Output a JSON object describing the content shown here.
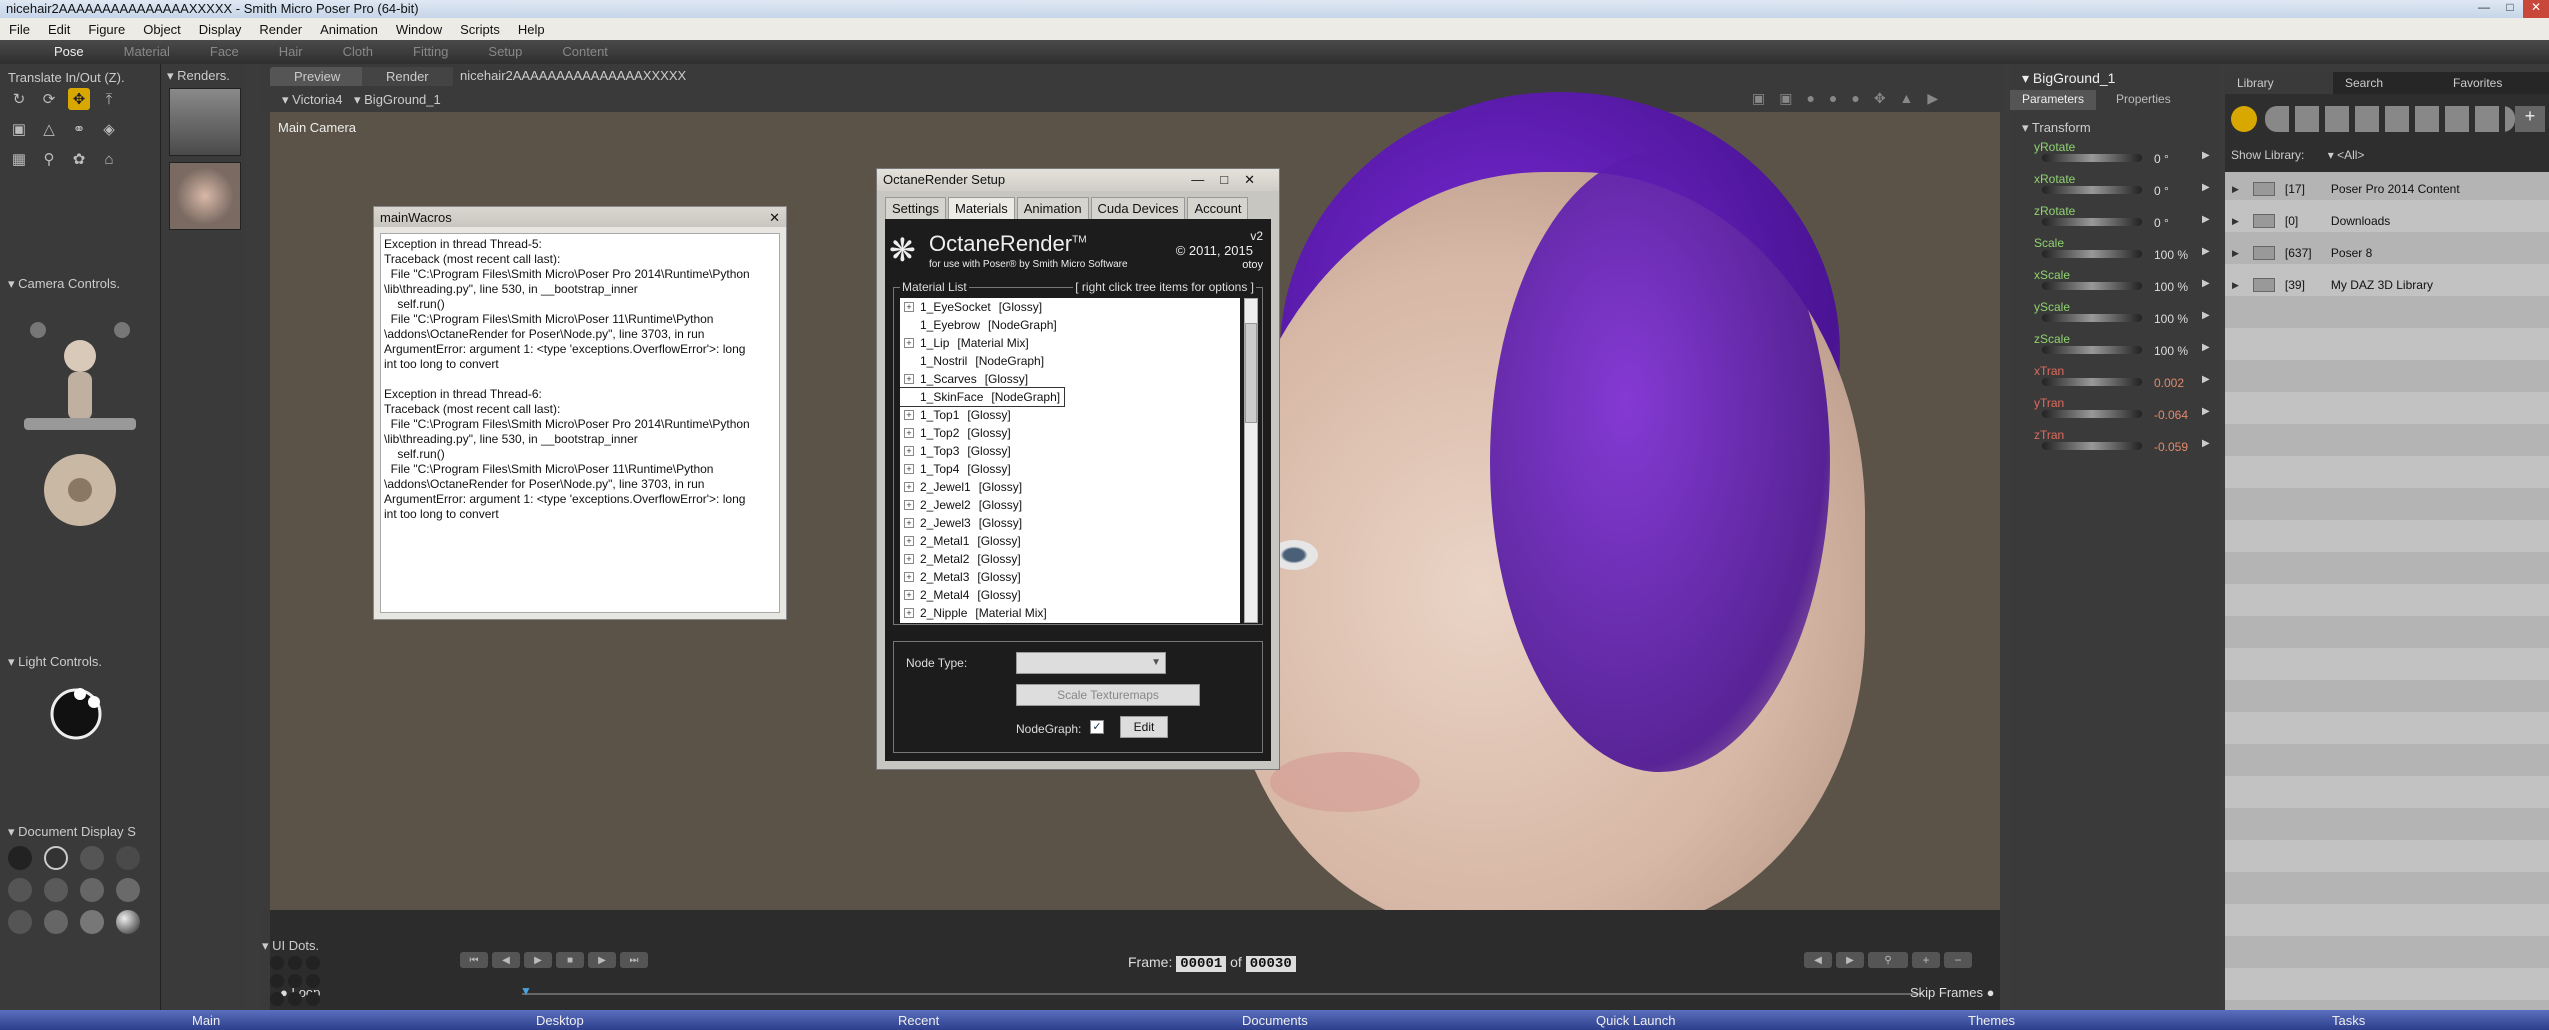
{
  "window": {
    "title": "nicehair2AAAAAAAAAAAAAAAXXXXX - Smith Micro Poser Pro  (64-bit)"
  },
  "menu": [
    "File",
    "Edit",
    "Figure",
    "Object",
    "Display",
    "Render",
    "Animation",
    "Window",
    "Scripts",
    "Help"
  ],
  "rooms": [
    "Pose",
    "Material",
    "Face",
    "Hair",
    "Cloth",
    "Fitting",
    "Setup",
    "Content"
  ],
  "tools": {
    "title": "Translate In/Out (Z)."
  },
  "renders": {
    "title": "Renders."
  },
  "doc_tabs": [
    "Preview",
    "Render"
  ],
  "doc_name": "nicehair2AAAAAAAAAAAAAAAXXXXX",
  "figure_menu": "Victoria4",
  "actor_menu": "BigGround_1",
  "camera_label": "Main Camera",
  "camera_controls": {
    "title": "Camera Controls."
  },
  "light_controls": {
    "title": "Light Controls."
  },
  "doc_display": {
    "title": "Document Display S"
  },
  "ui_dots": {
    "title": "UI Dots."
  },
  "mainwacros": {
    "title": "mainWacros",
    "text": "Exception in thread Thread-5:\nTraceback (most recent call last):\n  File \"C:\\Program Files\\Smith Micro\\Poser Pro 2014\\Runtime\\Python\n\\lib\\threading.py\", line 530, in __bootstrap_inner\n    self.run()\n  File \"C:\\Program Files\\Smith Micro\\Poser 11\\Runtime\\Python\n\\addons\\OctaneRender for Poser\\Node.py\", line 3703, in run\nArgumentError: argument 1: <type 'exceptions.OverflowError'>: long\nint too long to convert\n\nException in thread Thread-6:\nTraceback (most recent call last):\n  File \"C:\\Program Files\\Smith Micro\\Poser Pro 2014\\Runtime\\Python\n\\lib\\threading.py\", line 530, in __bootstrap_inner\n    self.run()\n  File \"C:\\Program Files\\Smith Micro\\Poser 11\\Runtime\\Python\n\\addons\\OctaneRender for Poser\\Node.py\", line 3703, in run\nArgumentError: argument 1: <type 'exceptions.OverflowError'>: long\nint too long to convert"
  },
  "octane": {
    "title": "OctaneRender Setup",
    "tabs": [
      "Settings",
      "Materials",
      "Animation",
      "Cuda Devices",
      "Account"
    ],
    "logo": "OctaneRender",
    "tm": "TM",
    "subtitle": "for use with Poser® by Smith Micro Software",
    "version": "v2",
    "copyright": "© 2011, 2015",
    "brand": "otoy",
    "list_title": "Material List",
    "list_hint": "[ right click tree items for options ]",
    "materials": [
      {
        "name": "1_EyeSocket",
        "type": "[Glossy]",
        "plus": true
      },
      {
        "name": "1_Eyebrow",
        "type": "[NodeGraph]",
        "plus": false
      },
      {
        "name": "1_Lip",
        "type": "[Material Mix]",
        "plus": true
      },
      {
        "name": "1_Nostril",
        "type": "[NodeGraph]",
        "plus": false
      },
      {
        "name": "1_Scarves",
        "type": "[Glossy]",
        "plus": true
      },
      {
        "name": "1_SkinFace",
        "type": "[NodeGraph]",
        "plus": false,
        "selected": true
      },
      {
        "name": "1_Top1",
        "type": "[Glossy]",
        "plus": true
      },
      {
        "name": "1_Top2",
        "type": "[Glossy]",
        "plus": true
      },
      {
        "name": "1_Top3",
        "type": "[Glossy]",
        "plus": true
      },
      {
        "name": "1_Top4",
        "type": "[Glossy]",
        "plus": true
      },
      {
        "name": "2_Jewel1",
        "type": "[Glossy]",
        "plus": true
      },
      {
        "name": "2_Jewel2",
        "type": "[Glossy]",
        "plus": true
      },
      {
        "name": "2_Jewel3",
        "type": "[Glossy]",
        "plus": true
      },
      {
        "name": "2_Metal1",
        "type": "[Glossy]",
        "plus": true
      },
      {
        "name": "2_Metal2",
        "type": "[Glossy]",
        "plus": true
      },
      {
        "name": "2_Metal3",
        "type": "[Glossy]",
        "plus": true
      },
      {
        "name": "2_Metal4",
        "type": "[Glossy]",
        "plus": true
      },
      {
        "name": "2_Nipple",
        "type": "[Material Mix]",
        "plus": true
      }
    ],
    "node_type_label": "Node Type:",
    "scale_button": "Scale Texturemaps",
    "nodegraph_label": "NodeGraph:",
    "edit_button": "Edit"
  },
  "parameters": {
    "actor": "BigGround_1",
    "tabs": [
      "Parameters",
      "Properties"
    ],
    "group": "Transform",
    "items": [
      {
        "name": "yRotate",
        "value": "0 °",
        "red": false
      },
      {
        "name": "xRotate",
        "value": "0 °",
        "red": false
      },
      {
        "name": "zRotate",
        "value": "0 °",
        "red": false
      },
      {
        "name": "Scale",
        "value": "100 %",
        "red": false
      },
      {
        "name": "xScale",
        "value": "100 %",
        "red": false
      },
      {
        "name": "yScale",
        "value": "100 %",
        "red": false
      },
      {
        "name": "zScale",
        "value": "100 %",
        "red": false
      },
      {
        "name": "xTran",
        "value": "0.002",
        "red": true
      },
      {
        "name": "yTran",
        "value": "-0.064",
        "red": true
      },
      {
        "name": "zTran",
        "value": "-0.059",
        "red": true
      }
    ]
  },
  "library": {
    "tabs": [
      "Library",
      "Search",
      "Favorites"
    ],
    "show_label": "Show Library:",
    "show_value": "<All>",
    "folders": [
      {
        "count": "[17]",
        "name": "Poser Pro 2014 Content"
      },
      {
        "count": "[0]",
        "name": "Downloads"
      },
      {
        "count": "[637]",
        "name": "Poser 8"
      },
      {
        "count": "[39]",
        "name": "My DAZ 3D Library"
      }
    ]
  },
  "timeline": {
    "frame_label": "Frame:",
    "frame": "00001",
    "of_label": "of",
    "total": "00030",
    "loop_label": "Loop",
    "skip_label": "Skip Frames"
  },
  "taskbar": [
    "Main",
    "Desktop",
    "Recent",
    "Documents",
    "Quick Launch",
    "Themes",
    "Tasks"
  ]
}
